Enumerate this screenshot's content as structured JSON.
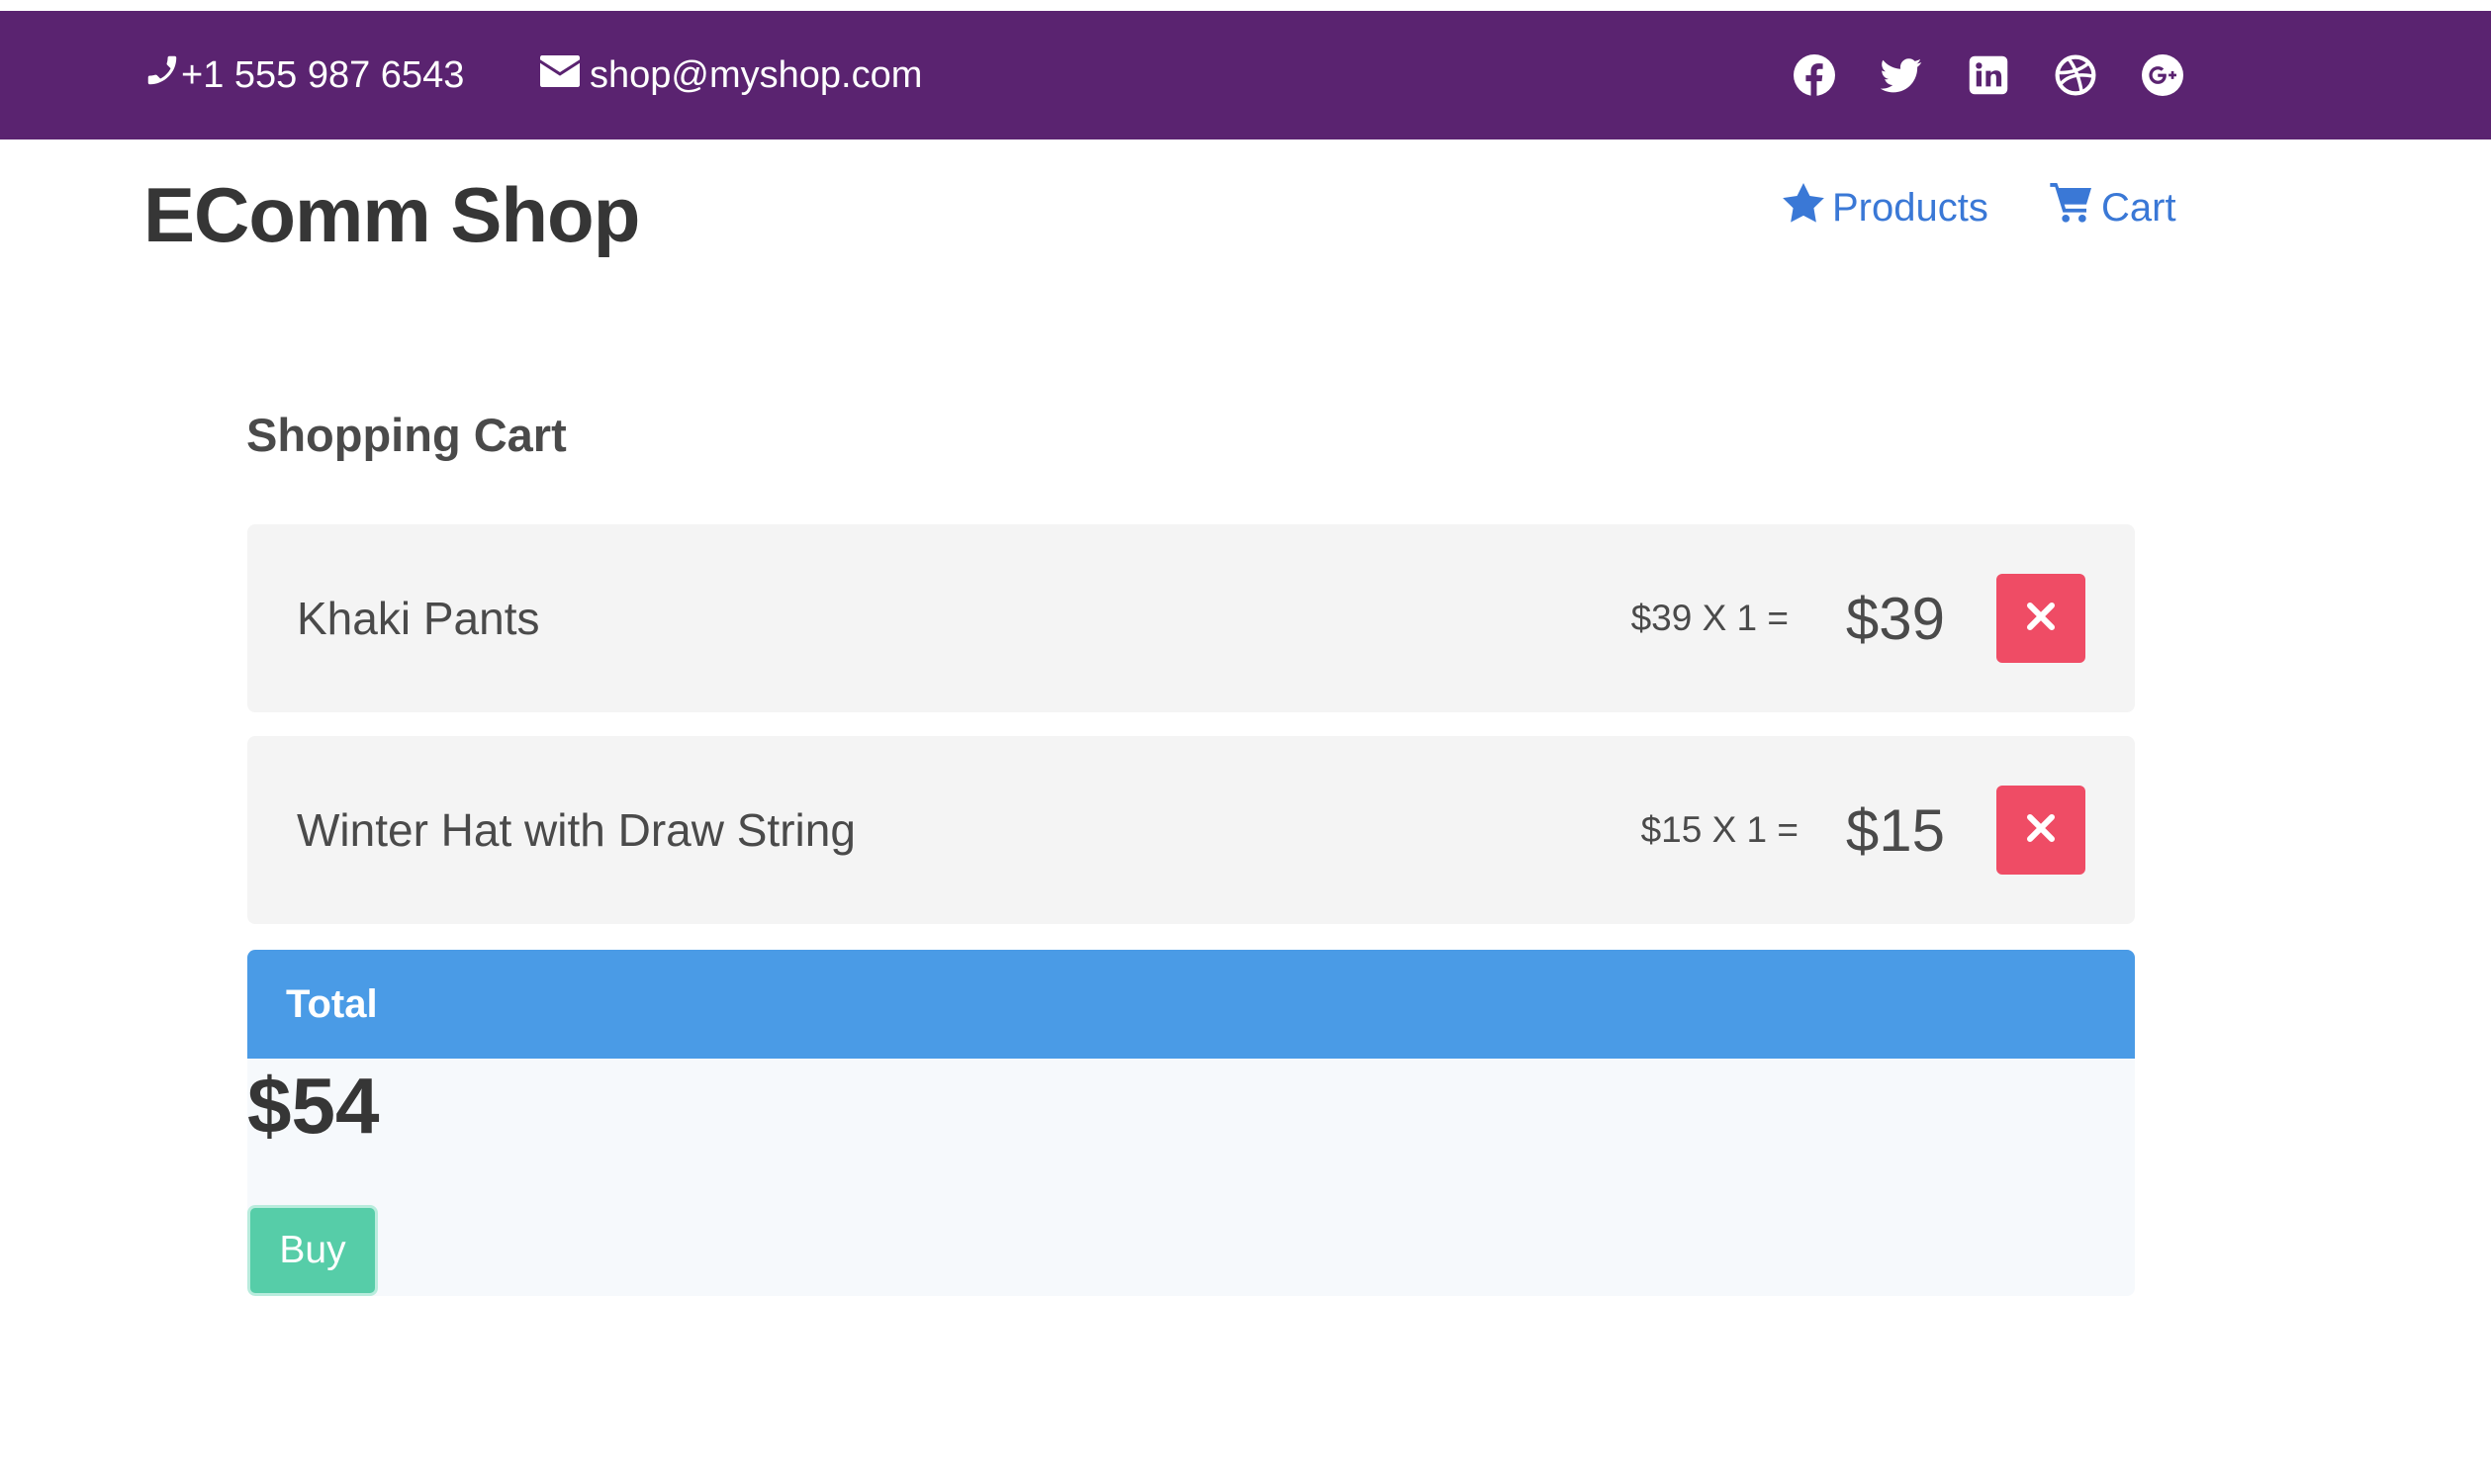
{
  "topbar": {
    "phone": "+1 555 987 6543",
    "email": "shop@myshop.com",
    "icons": [
      "phone-icon",
      "envelope-icon"
    ],
    "social": [
      "facebook-icon",
      "twitter-icon",
      "linkedin-icon",
      "dribbble-icon",
      "google-plus-icon"
    ],
    "background": "#5a2370"
  },
  "header": {
    "brand": "EComm Shop",
    "nav": [
      {
        "label": "Products",
        "icon": "star-icon"
      },
      {
        "label": "Cart",
        "icon": "cart-icon"
      }
    ],
    "link_color": "#3a78d6"
  },
  "cart": {
    "title": "Shopping Cart",
    "items": [
      {
        "name": "Khaki Pants",
        "formula": "$39 X 1 =",
        "subtotal": "$39"
      },
      {
        "name": "Winter Hat with Draw String",
        "formula": "$15 X 1 =",
        "subtotal": "$15"
      }
    ],
    "remove_color": "#ef4c65"
  },
  "total": {
    "label": "Total",
    "amount": "$54",
    "buy_label": "Buy",
    "header_color": "#4a9be6",
    "buy_color": "#56cda8"
  }
}
